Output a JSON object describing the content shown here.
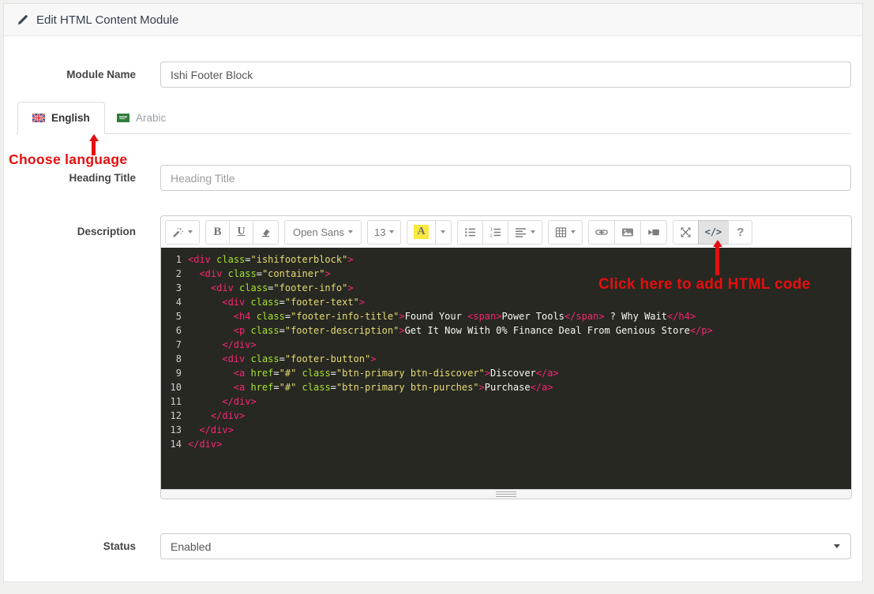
{
  "page": {
    "title": "Edit HTML Content Module"
  },
  "form": {
    "module_name": {
      "label": "Module Name",
      "value": "Ishi Footer Block"
    },
    "heading_title": {
      "label": "Heading Title",
      "placeholder": "Heading Title"
    },
    "description_label": "Description",
    "status": {
      "label": "Status",
      "value": "Enabled"
    }
  },
  "tabs": {
    "english": {
      "label": "English",
      "flag": "uk-flag-icon"
    },
    "arabic": {
      "label": "Arabic",
      "flag": "saudi-flag-icon"
    }
  },
  "annotations": {
    "choose_language": "Choose language",
    "click_code": "Click here to add HTML code"
  },
  "toolbar": {
    "style_button": "magic-wand",
    "bold": "B",
    "underline": "U",
    "font_family": "Open Sans",
    "font_size": "13",
    "color_letter": "A",
    "codeview": "</>",
    "help": "?"
  },
  "colors": {
    "accent_red": "#e60e0e",
    "code_bg": "#272822",
    "tag": "#f92672",
    "attr": "#a6e22e",
    "str": "#e6db74",
    "code_text": "#f8f8f2"
  },
  "editor": {
    "code_lines": [
      [
        [
          "g",
          "<div"
        ],
        [
          "w",
          " "
        ],
        [
          "a",
          "class"
        ],
        [
          "w",
          "="
        ],
        [
          "s",
          "\"ishifooterblock\""
        ],
        [
          "g",
          ">"
        ]
      ],
      [
        [
          "w",
          "  "
        ],
        [
          "g",
          "<div"
        ],
        [
          "w",
          " "
        ],
        [
          "a",
          "class"
        ],
        [
          "w",
          "="
        ],
        [
          "s",
          "\"container\""
        ],
        [
          "g",
          ">"
        ]
      ],
      [
        [
          "w",
          "    "
        ],
        [
          "g",
          "<div"
        ],
        [
          "w",
          " "
        ],
        [
          "a",
          "class"
        ],
        [
          "w",
          "="
        ],
        [
          "s",
          "\"footer-info\""
        ],
        [
          "g",
          ">"
        ]
      ],
      [
        [
          "w",
          "      "
        ],
        [
          "g",
          "<div"
        ],
        [
          "w",
          " "
        ],
        [
          "a",
          "class"
        ],
        [
          "w",
          "="
        ],
        [
          "s",
          "\"footer-text\""
        ],
        [
          "g",
          ">"
        ]
      ],
      [
        [
          "w",
          "        "
        ],
        [
          "g",
          "<h4"
        ],
        [
          "w",
          " "
        ],
        [
          "a",
          "class"
        ],
        [
          "w",
          "="
        ],
        [
          "s",
          "\"footer-info-title\""
        ],
        [
          "g",
          ">"
        ],
        [
          "w",
          "Found Your "
        ],
        [
          "g",
          "<span>"
        ],
        [
          "w",
          "Power Tools"
        ],
        [
          "g",
          "</span>"
        ],
        [
          "w",
          " ? Why Wait"
        ],
        [
          "g",
          "</h4>"
        ]
      ],
      [
        [
          "w",
          "        "
        ],
        [
          "g",
          "<p"
        ],
        [
          "w",
          " "
        ],
        [
          "a",
          "class"
        ],
        [
          "w",
          "="
        ],
        [
          "s",
          "\"footer-description\""
        ],
        [
          "g",
          ">"
        ],
        [
          "w",
          "Get It Now With 0% Finance Deal From Genious Store"
        ],
        [
          "g",
          "</p>"
        ]
      ],
      [
        [
          "w",
          "      "
        ],
        [
          "g",
          "</div>"
        ]
      ],
      [
        [
          "w",
          "      "
        ],
        [
          "g",
          "<div"
        ],
        [
          "w",
          " "
        ],
        [
          "a",
          "class"
        ],
        [
          "w",
          "="
        ],
        [
          "s",
          "\"footer-button\""
        ],
        [
          "g",
          ">"
        ]
      ],
      [
        [
          "w",
          "        "
        ],
        [
          "g",
          "<a"
        ],
        [
          "w",
          " "
        ],
        [
          "a",
          "href"
        ],
        [
          "w",
          "="
        ],
        [
          "s",
          "\"#\""
        ],
        [
          "w",
          " "
        ],
        [
          "a",
          "class"
        ],
        [
          "w",
          "="
        ],
        [
          "s",
          "\"btn-primary btn-discover\""
        ],
        [
          "g",
          ">"
        ],
        [
          "w",
          "Discover"
        ],
        [
          "g",
          "</a>"
        ]
      ],
      [
        [
          "w",
          "        "
        ],
        [
          "g",
          "<a"
        ],
        [
          "w",
          " "
        ],
        [
          "a",
          "href"
        ],
        [
          "w",
          "="
        ],
        [
          "s",
          "\"#\""
        ],
        [
          "w",
          " "
        ],
        [
          "a",
          "class"
        ],
        [
          "w",
          "="
        ],
        [
          "s",
          "\"btn-primary btn-purches\""
        ],
        [
          "g",
          ">"
        ],
        [
          "w",
          "Purchase"
        ],
        [
          "g",
          "</a>"
        ]
      ],
      [
        [
          "w",
          "      "
        ],
        [
          "g",
          "</div>"
        ]
      ],
      [
        [
          "w",
          "    "
        ],
        [
          "g",
          "</div>"
        ]
      ],
      [
        [
          "w",
          "  "
        ],
        [
          "g",
          "</div>"
        ]
      ],
      [
        [
          "g",
          "</div>"
        ]
      ]
    ]
  }
}
